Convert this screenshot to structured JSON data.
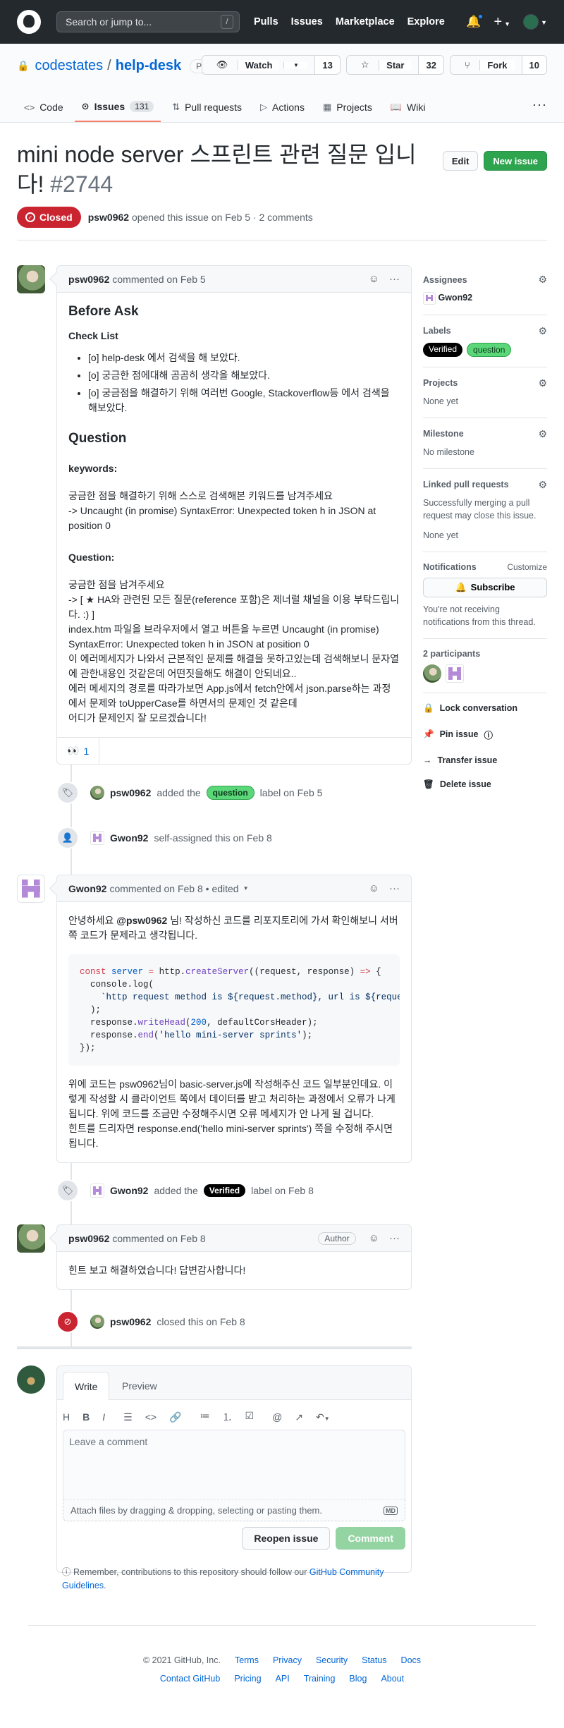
{
  "global_nav": {
    "search_placeholder": "Search or jump to...",
    "search_hotkey": "/",
    "links": [
      "Pulls",
      "Issues",
      "Marketplace",
      "Explore"
    ]
  },
  "repo": {
    "owner": "codestates",
    "separator": "/",
    "name": "help-desk",
    "visibility": "Private",
    "watch_label": "Watch",
    "watch_count": "13",
    "star_label": "Star",
    "star_count": "32",
    "fork_label": "Fork",
    "fork_count": "10",
    "tabs": [
      {
        "label": "Code",
        "icon": "code-icon"
      },
      {
        "label": "Issues",
        "icon": "issue-icon",
        "count": "131"
      },
      {
        "label": "Pull requests",
        "icon": "pull-request-icon"
      },
      {
        "label": "Actions",
        "icon": "play-icon"
      },
      {
        "label": "Projects",
        "icon": "project-icon"
      },
      {
        "label": "Wiki",
        "icon": "book-icon"
      }
    ]
  },
  "issue": {
    "title": "mini node server 스프린트 관련 질문 입니다!",
    "number": "#2744",
    "edit_label": "Edit",
    "new_issue_label": "New issue",
    "state": "Closed",
    "author": "psw0962",
    "meta": "opened this issue on Feb 5 · 2 comments"
  },
  "comment1": {
    "author": "psw0962",
    "meta": "commented on Feb 5",
    "heading_before": "Before Ask",
    "heading_checklist": "Check List",
    "checklist": [
      "[o] help-desk 에서 검색을 해 보았다.",
      "[o] 궁금한 점에대해 곰곰히 생각을 해보았다.",
      "[o] 궁금점을 해결하기 위해 여러번 Google, Stackoverflow등 에서 검색을 해보았다."
    ],
    "heading_question": "Question",
    "keywords_label": "keywords:",
    "keywords_text": "궁금한 점을 해결하기 위해 스스로 검색해본 키워드를 남겨주세요\n-> Uncaught (in promise) SyntaxError: Unexpected token h in JSON at position 0",
    "question_label": "Question:",
    "question_text": "궁금한 점을 남겨주세요\n-> [ ★ HA와 관련된 모든 질문(reference 포함)은 제너럴 채널을 이용 부탁드립니다. :) ]\nindex.htm 파일을 브라우저에서 열고 버튼을 누르면 Uncaught (in promise) SyntaxError: Unexpected token h in JSON at position 0\n이 에러메세지가 나와서 근본적인 문제를 해결을 못하고있는데 검색해보니 문자열에 관한내용인 것같은데 어떤짓을해도 해결이 안되네요..\n에러 메세지의 경로를 따라가보면 App.js에서 fetch안에서 json.parse하는 과정에서 문제와 toUpperCase를 하면서의 문제인 것 같은데\n어디가 문제인지 잘 모르겠습니다!",
    "reaction_emoji": "👀",
    "reaction_count": "1"
  },
  "event_label_question": {
    "actor": "psw0962",
    "action": "added the",
    "label": "question",
    "suffix": "label on Feb 5"
  },
  "event_assign": {
    "actor": "Gwon92",
    "text": "self-assigned this on Feb 8"
  },
  "comment2": {
    "author": "Gwon92",
    "meta": "commented on Feb 8 • edited",
    "mention": "@psw0962",
    "intro_pre": "안녕하세요 ",
    "intro_post": " 님! 작성하신 코드를 리포지토리에 가서 확인해보니 서버 쪽 코드가 문제라고 생각됩니다.",
    "code_lines": [
      "const server = http.createServer((request, response) => {",
      "  console.log(",
      "    `http request method is ${request.method}, url is ${request.",
      "  );",
      "  response.writeHead(200, defaultCorsHeader);",
      "  response.end('hello mini-server sprints');",
      "});"
    ],
    "outro": "위에 코드는 psw0962님이 basic-server.js에 작성해주신 코드 일부분인데요. 이렇게 작성할 시 클라이언트 쪽에서 데이터를 받고 처리하는 과정에서 오류가 나게 됩니다. 위에 코드를 조금만 수정해주시면 오류 메세지가 안 나게 될 겁니다.\n힌트를 드리자면 response.end('hello mini-server sprints') 쪽을 수정해 주시면 됩니다."
  },
  "event_label_verified": {
    "actor": "Gwon92",
    "action": "added the",
    "label": "Verified",
    "suffix": "label on Feb 8"
  },
  "comment3": {
    "author": "psw0962",
    "meta": "commented on Feb 8",
    "badge": "Author",
    "body": "힌트 보고 해결하였습니다! 답변감사합니다!"
  },
  "event_closed": {
    "actor": "psw0962",
    "text": "closed this on Feb 8"
  },
  "composer": {
    "tab_write": "Write",
    "tab_preview": "Preview",
    "placeholder": "Leave a comment",
    "attach_text": "Attach files by dragging & dropping, selecting or pasting them.",
    "markdown_badge": "MD",
    "reopen_label": "Reopen issue",
    "comment_label": "Comment",
    "tip_pre": "Remember, contributions to this repository should follow our ",
    "tip_link": "GitHub Community Guidelines",
    "tip_post": "."
  },
  "sidebar": {
    "assignees_title": "Assignees",
    "assignee": "Gwon92",
    "labels_title": "Labels",
    "labels": [
      "Verified",
      "question"
    ],
    "projects_title": "Projects",
    "projects_value": "None yet",
    "milestone_title": "Milestone",
    "milestone_value": "No milestone",
    "linked_title": "Linked pull requests",
    "linked_desc": "Successfully merging a pull request may close this issue.",
    "linked_value": "None yet",
    "notifications_title": "Notifications",
    "customize": "Customize",
    "subscribe_label": "Subscribe",
    "notifications_desc": "You're not receiving notifications from this thread.",
    "participants_title": "2 participants",
    "lock_label": "Lock conversation",
    "pin_label": "Pin issue",
    "transfer_label": "Transfer issue",
    "delete_label": "Delete issue"
  },
  "footer": {
    "copyright": "© 2021 GitHub, Inc.",
    "row1": [
      "Terms",
      "Privacy",
      "Security",
      "Status",
      "Docs"
    ],
    "row2": [
      "Contact GitHub",
      "Pricing",
      "API",
      "Training",
      "Blog",
      "About"
    ]
  },
  "colors": {
    "closed": "#cb2431",
    "accent": "#0366d6",
    "green": "#2ea44f",
    "tab_underline": "#f9826c"
  }
}
